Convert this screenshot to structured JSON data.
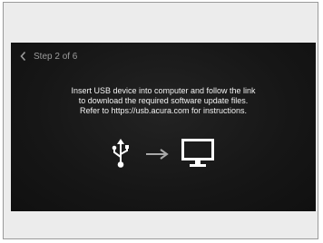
{
  "step": {
    "label": "Step 2 of 6"
  },
  "message": {
    "line1": "Insert USB device into computer and follow the link",
    "line2": "to download the required software update files.",
    "line3": "Refer to https://usb.acura.com for instructions."
  },
  "icons": {
    "back": "chevron-left-icon",
    "usb": "usb-icon",
    "arrow": "arrow-right-icon",
    "monitor": "computer-monitor-icon"
  },
  "colors": {
    "screen_bg": "#161616",
    "text": "#f2f2f2",
    "muted": "#9b9b9b"
  }
}
